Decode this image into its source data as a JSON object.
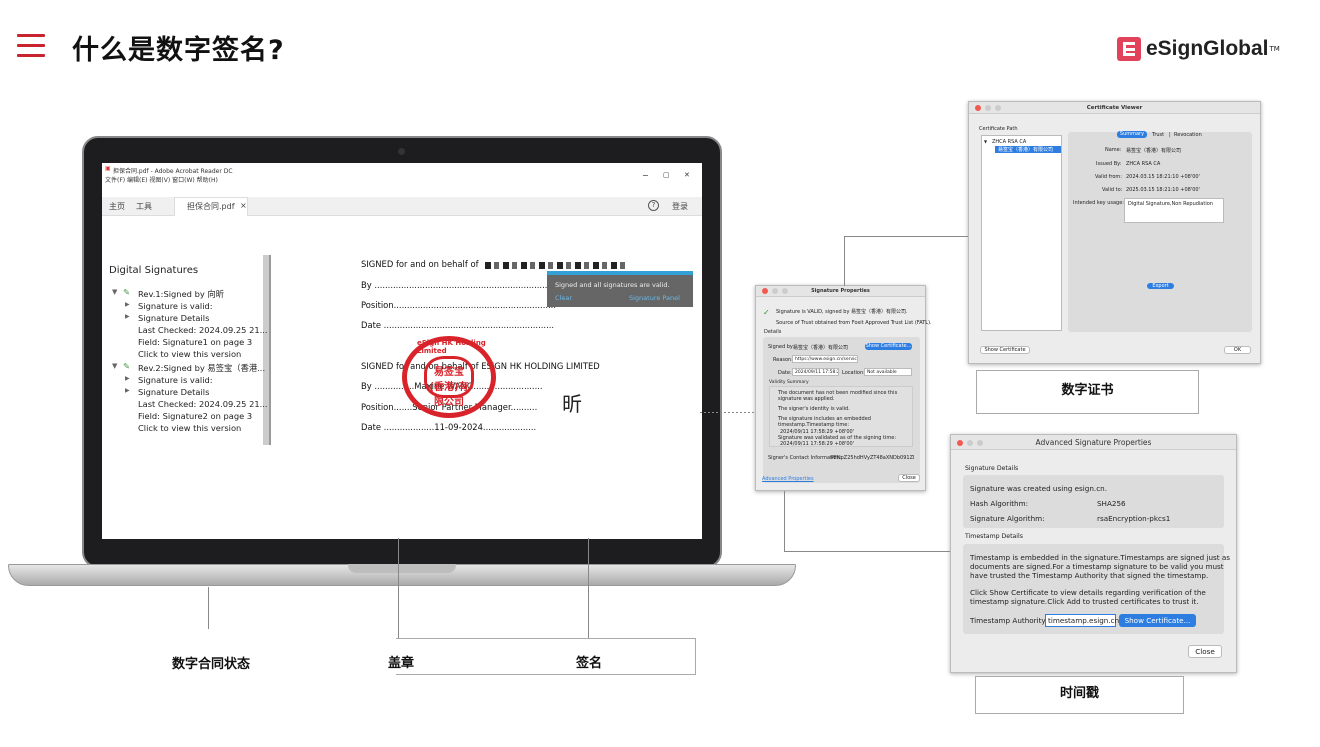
{
  "header": {
    "title": "什么是数字签名?",
    "logo_text": "eSignGlobal",
    "logo_tm": "TM"
  },
  "acrobat": {
    "window_title": "担保合同.pdf - Adobe Acrobat Reader DC",
    "menu": "文件(F)  编辑(E)  视图(V)  窗口(W)  帮助(H)",
    "win_controls": [
      "−",
      "▢",
      "✕"
    ],
    "tabs": {
      "home": "主页",
      "tools": "工具",
      "doc": "担保合同.pdf",
      "doc_close": "×",
      "help": "?",
      "login": "登录"
    },
    "panel": {
      "title": "Digital Signatures",
      "rev1": {
        "label": "Rev.1:Signed by 向昕",
        "valid": "Signature is valid:",
        "details": "Signature Details",
        "checked": "Last Checked: 2024.09.25 21...",
        "field": "Field: Signature1 on page 3",
        "click": "Click to view this version"
      },
      "rev2": {
        "label": "Rev.2:Signed by 易签宝（香港...",
        "valid": "Signature is valid:",
        "details": "Signature Details",
        "checked": "Last Checked: 2024.09.25 21...",
        "field": "Field: Signature2 on page 3",
        "click": "Click to view this version"
      }
    },
    "doc": {
      "signed1": "SIGNED for and on behalf of",
      "by": "By ..................................................................",
      "position": "Position.............................................................",
      "date": "Date ................................................................",
      "signed2": "SIGNED for and on behalf of ESIGN HK HOLDING LIMITED",
      "by2": "By ...............Maxine WANG..........................",
      "position2": "Position.......Senior Partner Manager..........",
      "date2": "Date ...................11-09-2024....................",
      "signature_mark": "昕"
    },
    "tooltip": {
      "text": "Signed and all signatures are valid.",
      "clear": "Clear",
      "panel": "Signature Panel"
    },
    "seal": {
      "inner": "易签宝(香港)有限公司",
      "ring": "eSign HK Holding Limited"
    }
  },
  "sig_props": {
    "title": "Signature Properties",
    "valid": "Signature is VALID, signed by 易签宝（香港）有限公司.",
    "trust": "Source of Trust obtained from Foxit Approved Trust List (FATL).",
    "details": "Details",
    "signed_by_label": "Signed by:",
    "signed_by": "易签宝（香港）有限公司",
    "show_cert": "Show Certificate...",
    "reason_label": "Reason:",
    "reason": "https://www.esign.cn/servicede",
    "date_label": "Date:",
    "date": "2024/09/11 17:58:29",
    "location_label": "Location:",
    "location": "Not available",
    "validity": "Validity Summary",
    "v1": "The document has not been modified since this signature was applied.",
    "v2": "The signer's identity is valid.",
    "v3": "The signature includes an embedded timestamp.Timestamp time:",
    "v3b": "2024/09/11 17:58:29 +08'00'",
    "v4": "Signature was validated as of the signing time:",
    "v4b": "2024/09/11 17:58:29 +08'00'",
    "contact_label": "Signer's Contact Information:",
    "contact": "PFNpZ25hdHVyZT48aXNDb091ZD4vPC",
    "advanced": "Advanced Properties",
    "close": "Close"
  },
  "cert": {
    "title": "Certificate Viewer",
    "path_label": "Certificate Path",
    "tree": [
      "ZHCA RSA CA",
      "易签宝（香港）有限公司"
    ],
    "tabs": [
      "Summary",
      "Trust",
      "Revocation"
    ],
    "name_label": "Name:",
    "name": "易签宝（香港）有限公司",
    "issued_label": "Issued By:",
    "issued": "ZHCA RSA CA",
    "from_label": "Valid from:",
    "from": "2024.03.15 18:21:10 +08'00'",
    "to_label": "Valid to:",
    "to": "2025.03.15 18:21:10 +08'00'",
    "usage_label": "Intended key usage:",
    "usage": "Digital Signature,Non Repudiation",
    "export": "Export",
    "show": "Show Certificate",
    "ok": "OK"
  },
  "adv": {
    "title": "Advanced Signature Properties",
    "sig_details": "Signature Details",
    "created": "Signature was created using esign.cn.",
    "hash_label": "Hash Algorithm:",
    "hash": "SHA256",
    "alg_label": "Signature Algorithm:",
    "alg": "rsaEncryption-pkcs1",
    "ts_details": "Timestamp Details",
    "ts1": "Timestamp is embedded in the signature.Timestamps are signed just as",
    "ts2": "documents are signed.For a timestamp signature to be valid you must",
    "ts3": "have trusted the Timestamp Authority that signed the timestamp.",
    "ts4": "Click Show Certificate to view details regarding verification of the",
    "ts5": "timestamp signature.Click Add to trusted certificates to trust it.",
    "auth_label": "Timestamp Authority:",
    "auth": "timestamp.esign.cn",
    "show": "Show Certificate...",
    "close": "Close"
  },
  "captions": {
    "cert": "数字证书",
    "timestamp": "时间戳",
    "status": "数字合同状态",
    "seal": "盖章",
    "sign": "签名"
  }
}
